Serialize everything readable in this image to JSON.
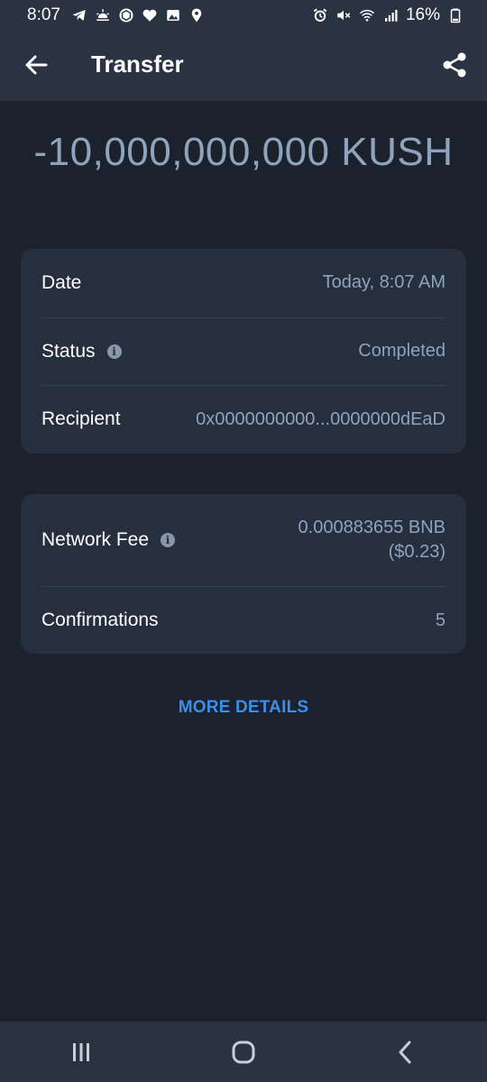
{
  "status_bar": {
    "time": "8:07",
    "battery": "16%",
    "left_icons": [
      "telegram-icon",
      "sunrise-icon",
      "crypto-com-icon",
      "heart-icon",
      "image-icon",
      "location-pin-icon"
    ],
    "right_icons": [
      "alarm-icon",
      "mute-icon",
      "wifi-icon",
      "signal-icon",
      "battery-icon"
    ]
  },
  "app_bar": {
    "title": "Transfer",
    "back_icon": "arrow-left-icon",
    "share_icon": "share-icon"
  },
  "amount": "-10,000,000,000 KUSH",
  "details": {
    "date_label": "Date",
    "date_value": "Today, 8:07 AM",
    "status_label": "Status",
    "status_value": "Completed",
    "recipient_label": "Recipient",
    "recipient_value": "0x0000000000...0000000dEaD"
  },
  "fees": {
    "fee_label": "Network Fee",
    "fee_value_line1": "0.000883655 BNB",
    "fee_value_line2": "($0.23)",
    "confirmations_label": "Confirmations",
    "confirmations_value": "5"
  },
  "more_details": "MORE DETAILS",
  "colors": {
    "background": "#1b222d",
    "bar": "#2a3341",
    "card": "#252f3d",
    "muted_text": "#8fa3bd",
    "link": "#3d8fe6"
  }
}
